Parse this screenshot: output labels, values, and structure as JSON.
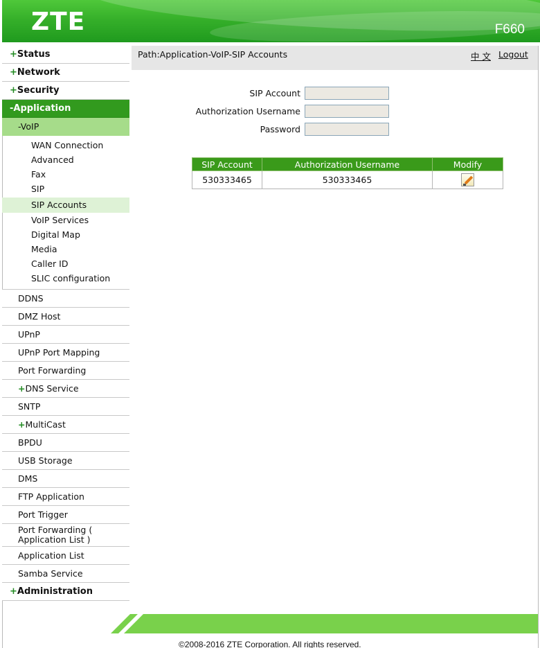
{
  "header": {
    "logo": "ZTE",
    "model": "F660"
  },
  "path": {
    "text": "Path:Application-VoIP-SIP Accounts",
    "lang": "中 文",
    "logout": "Logout"
  },
  "sidebar": {
    "status": {
      "sign": "+",
      "label": "Status"
    },
    "network": {
      "sign": "+",
      "label": "Network"
    },
    "security": {
      "sign": "+",
      "label": "Security"
    },
    "application": {
      "sign": "-",
      "label": "Application"
    },
    "voip": {
      "sign": "-",
      "label": "VoIP"
    },
    "voip_items": [
      "WAN Connection",
      "Advanced",
      "Fax",
      "SIP",
      "SIP Accounts",
      "VoIP Services",
      "Digital Map",
      "Media",
      "Caller ID",
      "SLIC configuration"
    ],
    "app_items": [
      {
        "sign": "",
        "label": "DDNS"
      },
      {
        "sign": "",
        "label": "DMZ Host"
      },
      {
        "sign": "",
        "label": "UPnP"
      },
      {
        "sign": "",
        "label": "UPnP Port Mapping"
      },
      {
        "sign": "",
        "label": "Port Forwarding"
      },
      {
        "sign": "+",
        "label": "DNS Service"
      },
      {
        "sign": "",
        "label": "SNTP"
      },
      {
        "sign": "+",
        "label": "MultiCast"
      },
      {
        "sign": "",
        "label": "BPDU"
      },
      {
        "sign": "",
        "label": "USB Storage"
      },
      {
        "sign": "",
        "label": "DMS"
      },
      {
        "sign": "",
        "label": "FTP Application"
      },
      {
        "sign": "",
        "label": "Port Trigger"
      },
      {
        "sign": "",
        "label": "Port Forwarding ( Application List )"
      },
      {
        "sign": "",
        "label": "Application List"
      },
      {
        "sign": "",
        "label": "Samba Service"
      }
    ],
    "administration": {
      "sign": "+",
      "label": "Administration"
    }
  },
  "form": {
    "sip_account_label": "SIP Account",
    "sip_account_value": "",
    "auth_username_label": "Authorization Username",
    "auth_username_value": "",
    "password_label": "Password",
    "password_value": ""
  },
  "table": {
    "headers": [
      "SIP Account",
      "Authorization Username",
      "Modify"
    ],
    "rows": [
      {
        "sip_account": "530333465",
        "auth_username": "530333465"
      }
    ]
  },
  "footer": {
    "copyright": "©2008-2016 ZTE Corporation. All rights reserved."
  },
  "icons": {
    "modify": "edit-pencil-icon"
  },
  "colors": {
    "header_green": "#36b02a",
    "nav_active": "#329a1e",
    "voip_highlight": "#a6dc8a",
    "table_header": "#3a9a1a",
    "footer_green": "#79d14b"
  }
}
